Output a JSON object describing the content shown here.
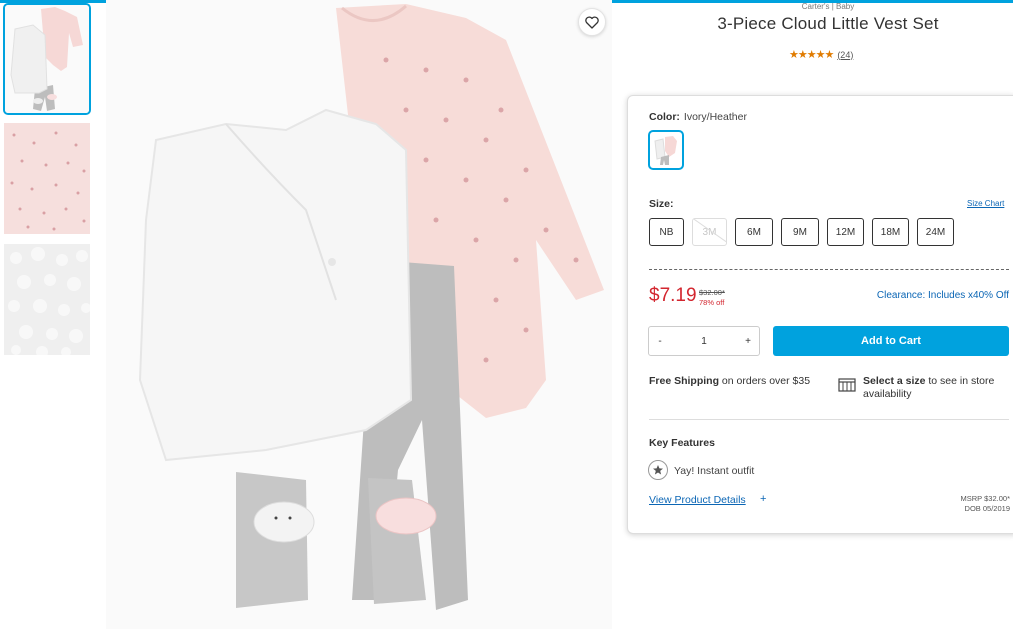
{
  "colors": {
    "accent": "#00a2de",
    "sale": "#d3262f",
    "link": "#0b66b5",
    "star": "#e07b00"
  },
  "product": {
    "brand": "Carter's | Baby",
    "title": "3-Piece Cloud Little Vest Set",
    "stars": "★★★★★",
    "review_count": "(24)"
  },
  "color_selector": {
    "label": "Color:",
    "value": "Ivory/Heather"
  },
  "size_selector": {
    "label": "Size:",
    "chart_link": "Size Chart",
    "sizes": [
      {
        "label": "NB",
        "available": true
      },
      {
        "label": "3M",
        "available": false
      },
      {
        "label": "6M",
        "available": true
      },
      {
        "label": "9M",
        "available": true
      },
      {
        "label": "12M",
        "available": true
      },
      {
        "label": "18M",
        "available": true
      },
      {
        "label": "24M",
        "available": true
      }
    ]
  },
  "pricing": {
    "price": "$7.19",
    "original": "$32.00*",
    "discount": "78% off",
    "clearance": "Clearance: Includes x40% Off"
  },
  "cart": {
    "qty_minus": "-",
    "qty_value": "1",
    "qty_plus": "+",
    "add_label": "Add to Cart"
  },
  "shipping": {
    "bold": "Free Shipping",
    "text": " on orders over $35"
  },
  "store": {
    "bold": "Select a size",
    "text": " to see in store availability"
  },
  "features": {
    "title": "Key Features",
    "items": [
      "Yay! Instant outfit"
    ]
  },
  "details": {
    "link": "View Product Details",
    "plus": "+",
    "msrp": "MSRP $32.00*",
    "dob": "DOB 05/2019"
  },
  "icons": {
    "favorite": "heart-outline-icon",
    "store": "store-icon",
    "feature": "star-badge-icon"
  }
}
